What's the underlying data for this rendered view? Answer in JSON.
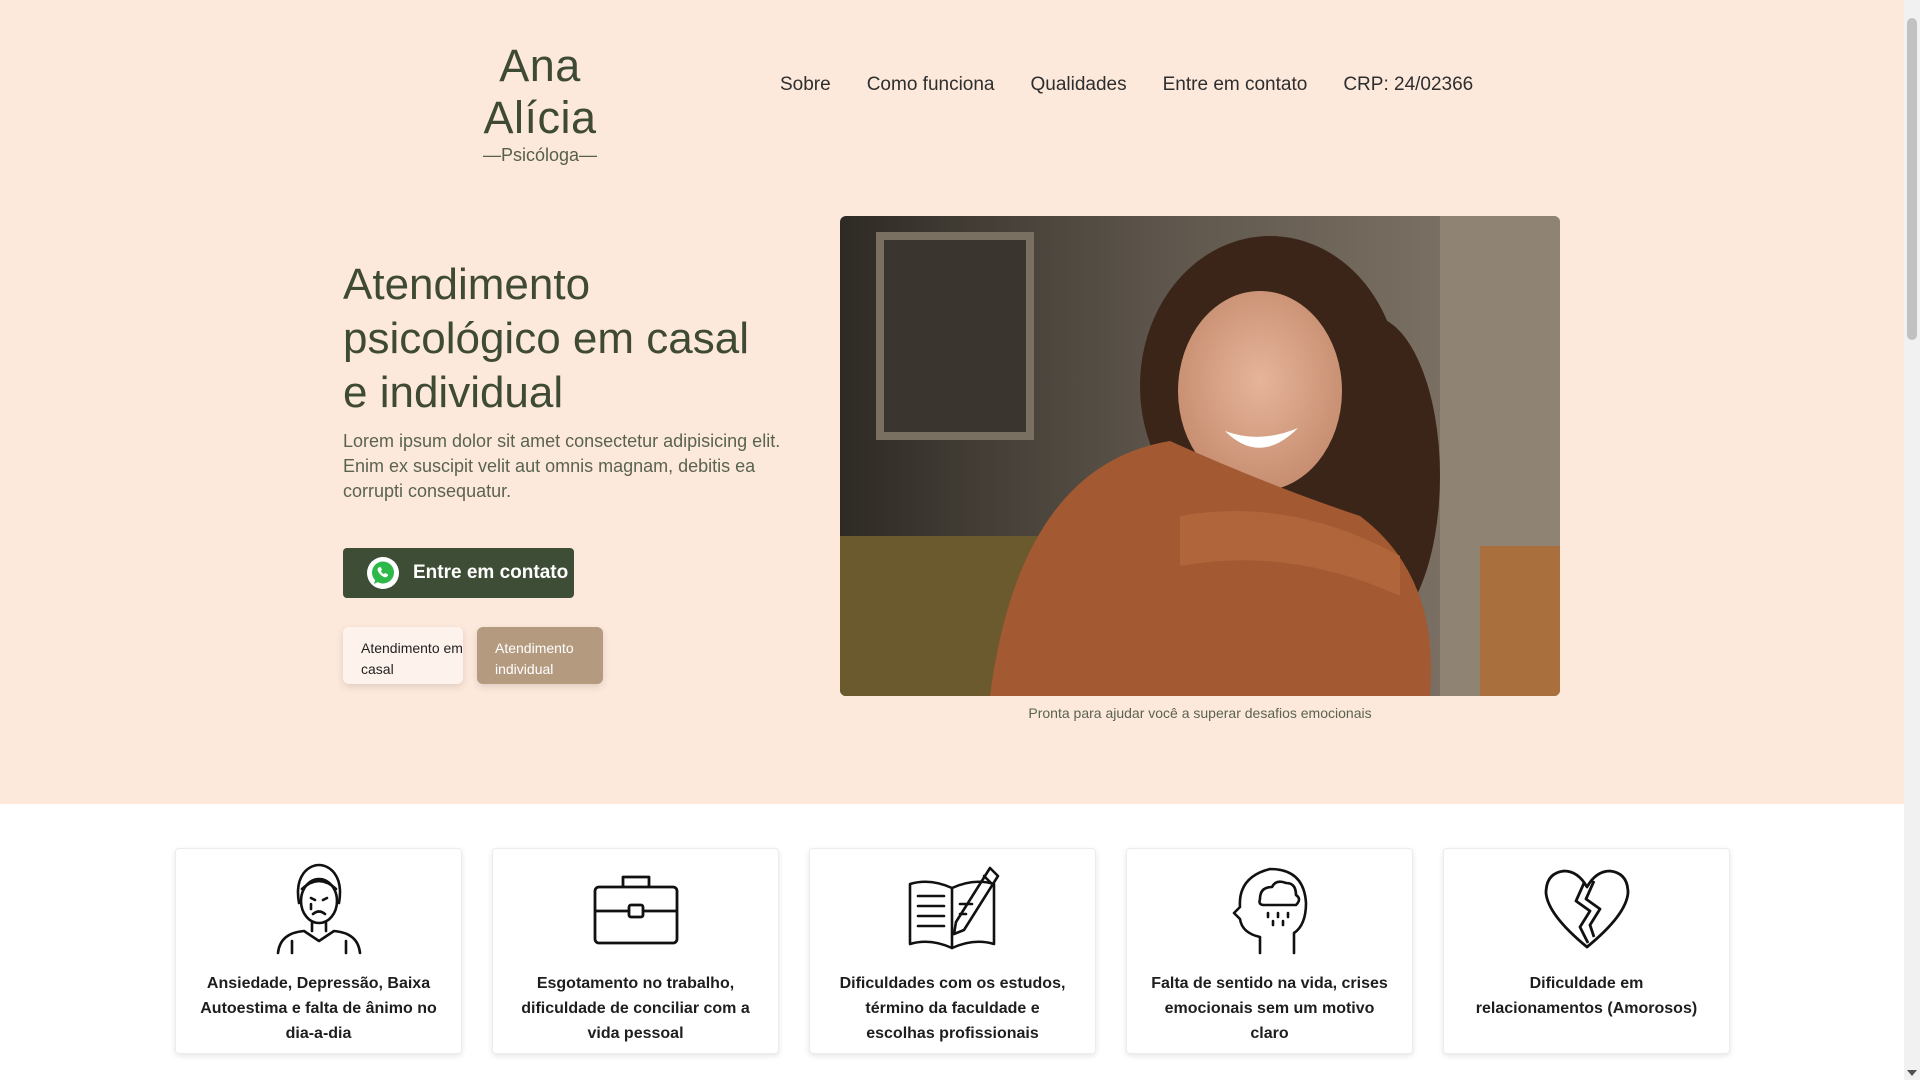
{
  "header": {
    "logo_name": "Ana Alícia",
    "logo_subtitle": "—Psicóloga—",
    "nav": [
      {
        "label": "Sobre",
        "icon": ""
      },
      {
        "label": "Como funciona",
        "icon": ""
      },
      {
        "label": "Qualidades",
        "icon": ""
      },
      {
        "label": "Entre em contato",
        "icon": ""
      },
      {
        "label": "CRP: 24/02366",
        "icon": ""
      }
    ]
  },
  "hero": {
    "headline": "Atendimento psicológico em casal e individual",
    "lead": "Lorem ipsum dolor sit amet consectetur adipisicing elit. Enim ex suscipit velit aut omnis magnam, debitis ea corrupti consequatur.",
    "cta_label": "Entre em contato",
    "cta_icon": "whatsapp-icon",
    "options": [
      {
        "label": "Atendimento em casal",
        "selected": false
      },
      {
        "label": "Atendimento individual",
        "selected": true
      }
    ],
    "photo_caption": "Pronta para ajudar você a superar desafios emocionais"
  },
  "cards": [
    {
      "icon": "sad-woman-icon",
      "text": "Ansiedade, Depressão, Baixa Autoestima e falta de ânimo no dia-a-dia"
    },
    {
      "icon": "briefcase-icon",
      "text": "Esgotamento no trabalho, dificuldade de conciliar com a vida pessoal"
    },
    {
      "icon": "open-book-pencil-icon",
      "text": "Dificuldades com os estudos, término da faculdade e escolhas profissionais"
    },
    {
      "icon": "head-raincloud-icon",
      "text": "Falta de sentido na vida, crises emocionais sem um motivo claro"
    },
    {
      "icon": "broken-heart-icon",
      "text": "Dificuldade em relacionamentos (Amorosos)"
    }
  ],
  "colors": {
    "hero_bg": "#fde9dc",
    "primary_green": "#3e4d35",
    "selected_pill": "#b49a7f",
    "text_dark": "#3f4a35"
  }
}
